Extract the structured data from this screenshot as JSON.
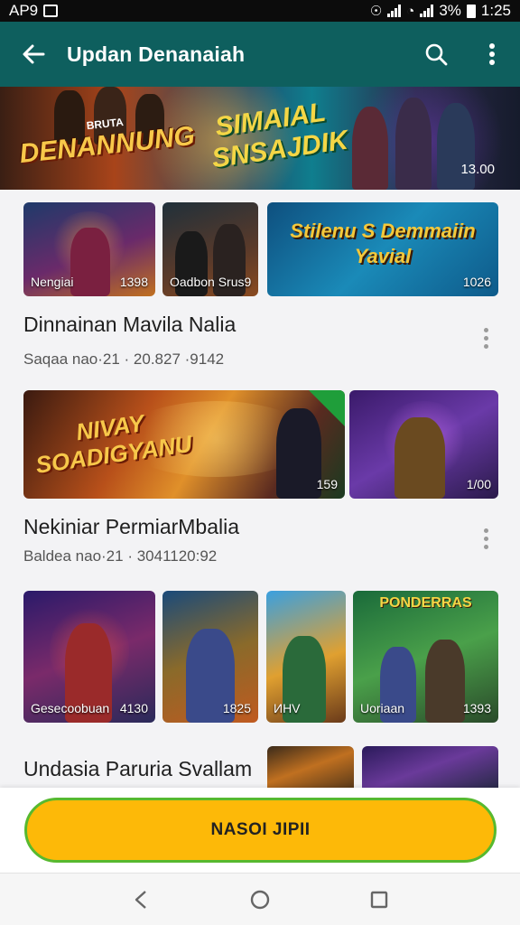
{
  "status_bar": {
    "carrier": "AP9",
    "battery": "3%",
    "time": "1:25"
  },
  "app_bar": {
    "title": "Updan Denanaiah"
  },
  "hero_banner": {
    "logo_left": "DENANNUNG",
    "logo_left_top": "BRUTA",
    "logo_right": "SIMAIAL SNSAJDIK",
    "count": "13.00"
  },
  "section1": {
    "cards": [
      {
        "label": "Nengiai",
        "count": "1398"
      },
      {
        "label": "Oadbon Srus9",
        "count": ""
      },
      {
        "label": "",
        "count": "1026",
        "art": "Stilenu S Demmaiin Yavial"
      }
    ],
    "title": "Dinnainan Mavila Nalia",
    "subtitle": "Saqaa nao·21 · 20.827 ·9142"
  },
  "section2": {
    "cards": [
      {
        "label": "",
        "count": "159",
        "art": "NIVAY SOADIGYANU"
      },
      {
        "label": "",
        "count": "1/00"
      }
    ],
    "title": "Nekiniar PermiarMbalia",
    "subtitle": "Baldea nao·21 · 3041120:92"
  },
  "section3": {
    "cards": [
      {
        "label": "Gesecoobuan",
        "count": "4130"
      },
      {
        "label": "",
        "count": "1825"
      },
      {
        "label": "ИHV",
        "count": ""
      },
      {
        "label": "Uoriaan",
        "count": "1393",
        "art": "PONDERRAS"
      }
    ],
    "title": "Undasia Paruria Svallam"
  },
  "cta": {
    "label": "NASOI JIPII"
  },
  "colors": {
    "app_bar": "#0e5f5e",
    "cta_fill": "#fdb908",
    "cta_border": "#57b92f"
  }
}
